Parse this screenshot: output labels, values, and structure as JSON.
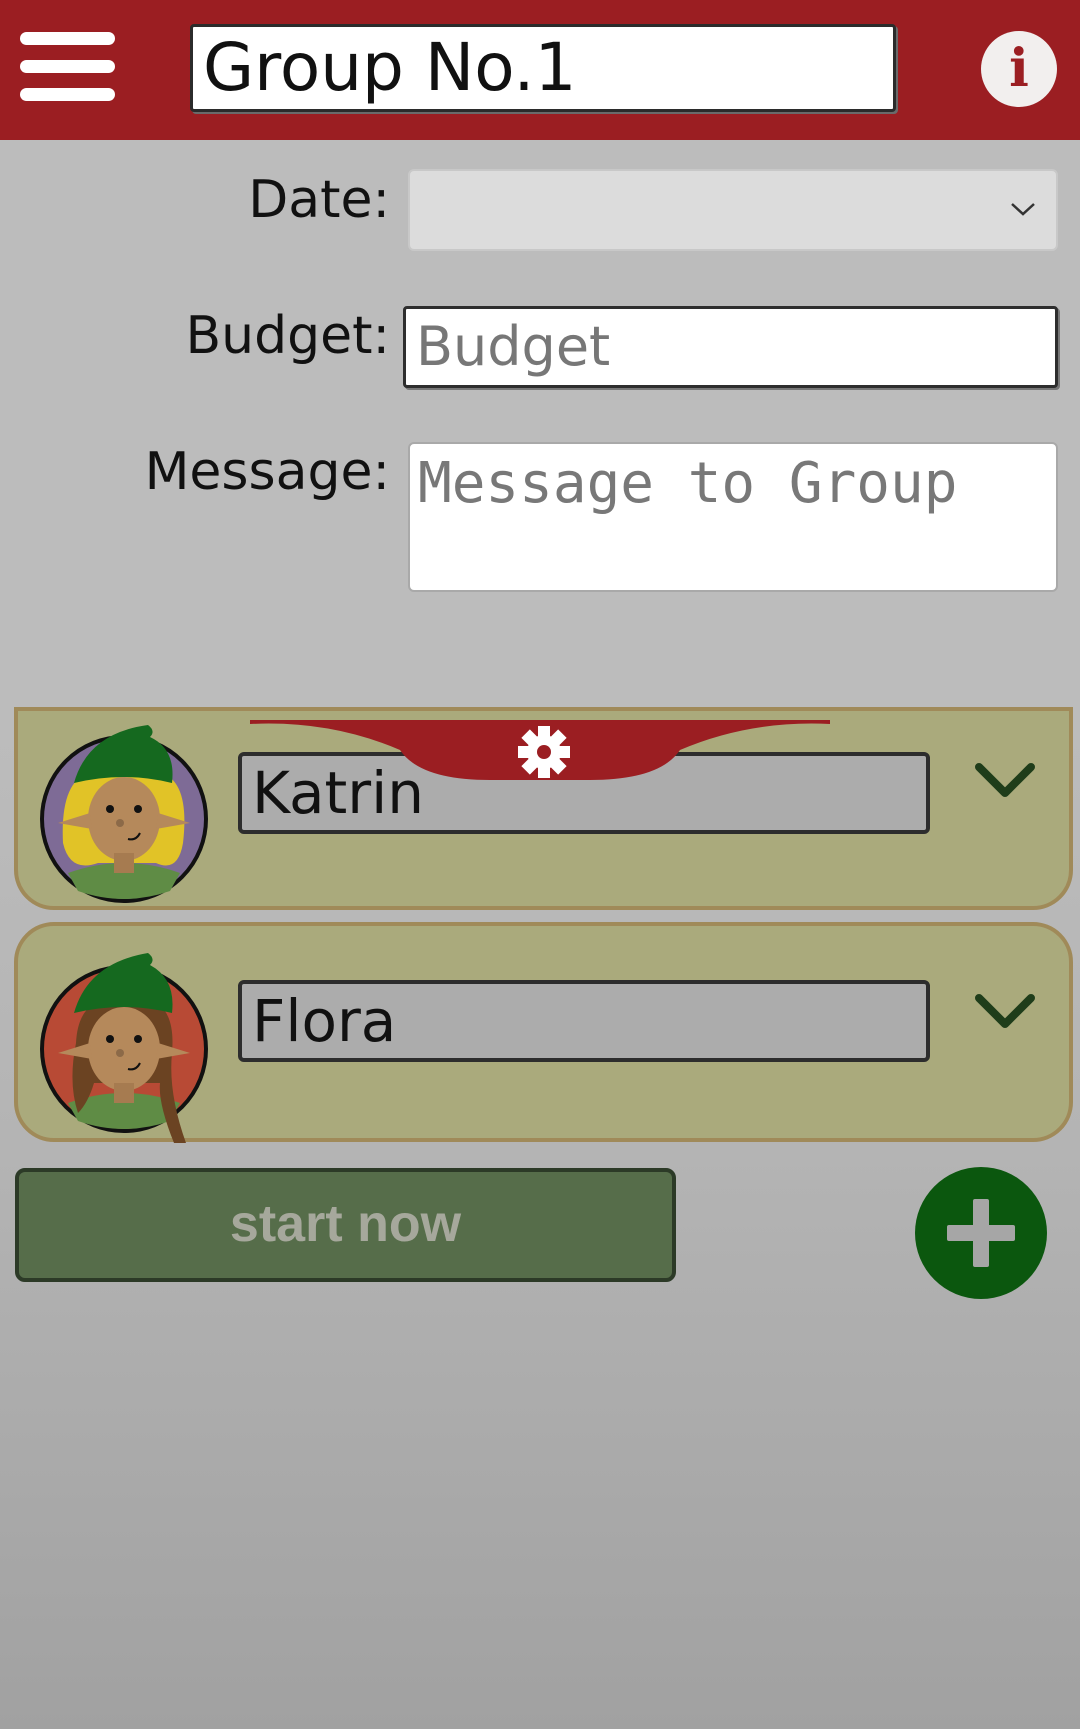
{
  "header": {
    "group_name": "Group No.1",
    "info_label": "i"
  },
  "form": {
    "date_label": "Date:",
    "date_value": "",
    "budget_label": "Budget:",
    "budget_placeholder": "Budget",
    "message_label": "Message:",
    "message_placeholder": "Message to Group"
  },
  "members": [
    {
      "name": "Katrin",
      "avatar_color": "#7e6b96",
      "hair_color": "#e1c327"
    },
    {
      "name": "Flora",
      "avatar_color": "#b84a35",
      "hair_color": "#6b4322"
    }
  ],
  "actions": {
    "start_label": "start now"
  },
  "colors": {
    "header": "#9b1e22",
    "card": "#aaaa7c",
    "start_button": "#566d4a",
    "add_button": "#0b570e"
  },
  "icons": {
    "menu": "hamburger-icon",
    "info": "info-icon",
    "settings": "gear-icon",
    "expand": "chevron-down-icon",
    "add": "plus-icon"
  }
}
